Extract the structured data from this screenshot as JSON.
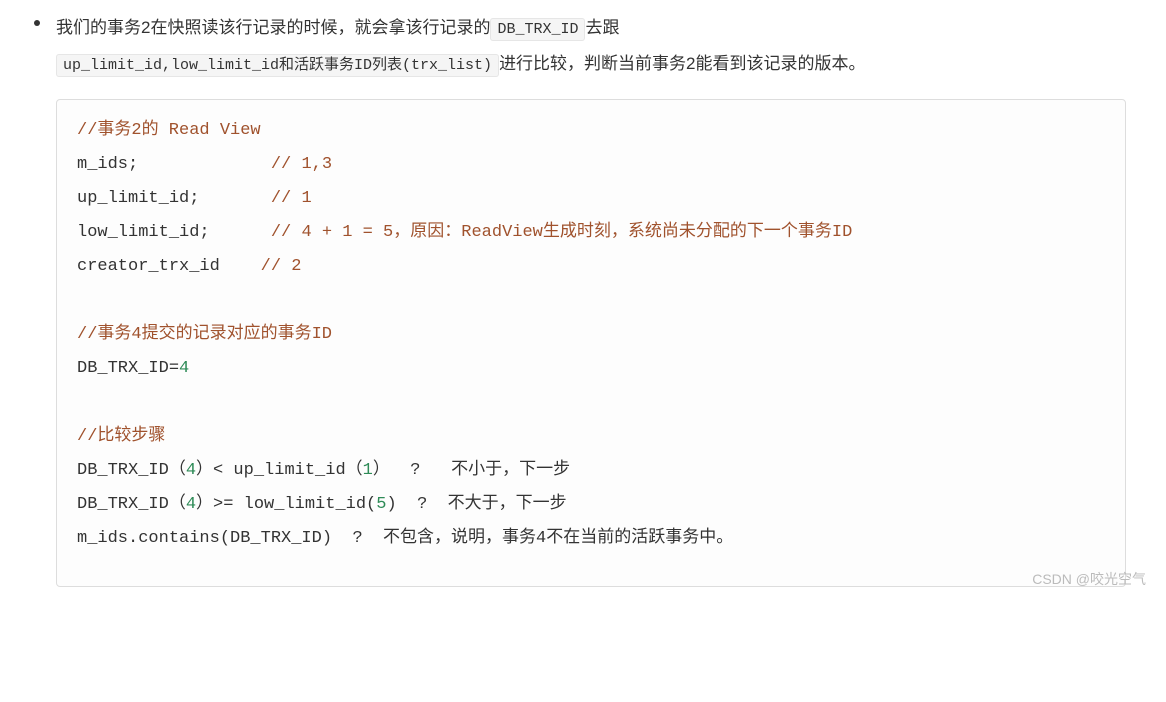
{
  "bullet": {
    "t1": "我们的事务2在快照读该行记录的时候，就会拿该行记录的",
    "code1": "DB_TRX_ID",
    "t2": "去跟",
    "code2": "up_limit_id,low_limit_id和活跃事务ID列表(trx_list)",
    "t3": "进行比较，判断当前事务2能看到该记录的版本。"
  },
  "code": {
    "c1": "//事务2的 Read View",
    "l2a": "m_ids;             ",
    "l2c": "// 1,3",
    "l3a": "up_limit_id;       ",
    "l3c": "// 1",
    "l4a": "low_limit_id;      ",
    "l4c": "// 4 + 1 = 5，原因：ReadView生成时刻，系统尚未分配的下一个事务ID",
    "l5a": "creator_trx_id    ",
    "l5c": "// 2",
    "c6": "//事务4提交的记录对应的事务ID",
    "l7a": "DB_TRX_ID=",
    "l7n": "4",
    "c8": "//比较步骤",
    "l9a": "DB_TRX_ID（",
    "l9n1": "4",
    "l9b": "）< up_limit_id（",
    "l9n2": "1",
    "l9c": "）  ?   不小于，下一步",
    "l10a": "DB_TRX_ID（",
    "l10n1": "4",
    "l10b": "）>= low_limit_id(",
    "l10n2": "5",
    "l10c": ")  ?  不大于，下一步",
    "l11": "m_ids.contains(DB_TRX_ID)  ?  不包含，说明，事务4不在当前的活跃事务中。"
  },
  "watermark": "CSDN @咬光空气"
}
